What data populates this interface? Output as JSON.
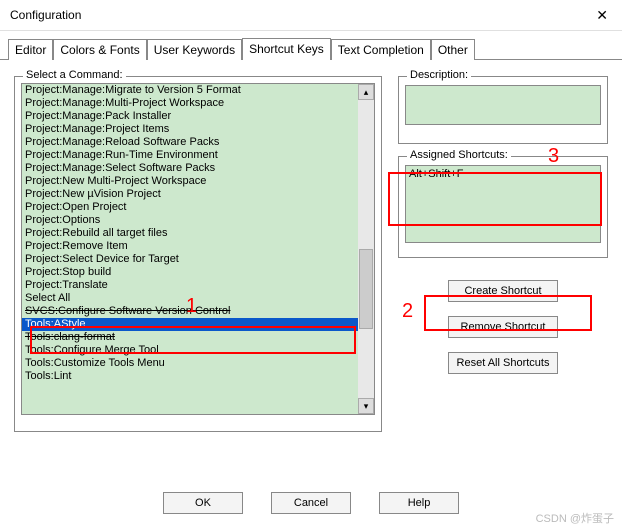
{
  "window": {
    "title": "Configuration"
  },
  "tabs": [
    {
      "label": "Editor"
    },
    {
      "label": "Colors & Fonts"
    },
    {
      "label": "User Keywords"
    },
    {
      "label": "Shortcut Keys"
    },
    {
      "label": "Text Completion"
    },
    {
      "label": "Other"
    }
  ],
  "active_tab_index": 3,
  "left_panel": {
    "label": "Select a Command:",
    "items": [
      {
        "text": "Project:Manage:Migrate to Version 5 Format"
      },
      {
        "text": "Project:Manage:Multi-Project Workspace"
      },
      {
        "text": "Project:Manage:Pack Installer"
      },
      {
        "text": "Project:Manage:Project Items"
      },
      {
        "text": "Project:Manage:Reload Software Packs"
      },
      {
        "text": "Project:Manage:Run-Time Environment"
      },
      {
        "text": "Project:Manage:Select Software Packs"
      },
      {
        "text": "Project:New Multi-Project Workspace"
      },
      {
        "text": "Project:New µVision Project"
      },
      {
        "text": "Project:Open Project"
      },
      {
        "text": "Project:Options"
      },
      {
        "text": "Project:Rebuild all target files"
      },
      {
        "text": "Project:Remove Item"
      },
      {
        "text": "Project:Select Device for Target"
      },
      {
        "text": "Project:Stop build"
      },
      {
        "text": "Project:Translate"
      },
      {
        "text": "Select All"
      },
      {
        "text": "SVCS:Configure Software Version Control",
        "strike": true
      },
      {
        "text": "Tools:AStyle",
        "selected": true
      },
      {
        "text": "Tools:clang-format",
        "strike": true
      },
      {
        "text": "Tools:Configure Merge Tool"
      },
      {
        "text": "Tools:Customize Tools Menu"
      },
      {
        "text": "Tools:Lint"
      }
    ]
  },
  "right_panel": {
    "description_label": "Description:",
    "assigned_label": "Assigned Shortcuts:",
    "assigned_value": "Alt+Shift+F",
    "buttons": {
      "create": "Create Shortcut",
      "remove": "Remove Shortcut",
      "reset": "Reset All Shortcuts"
    }
  },
  "footer": {
    "ok": "OK",
    "cancel": "Cancel",
    "help": "Help"
  },
  "annotations": {
    "one": "1",
    "two": "2",
    "three": "3"
  },
  "watermark": "CSDN @炸蛋子"
}
